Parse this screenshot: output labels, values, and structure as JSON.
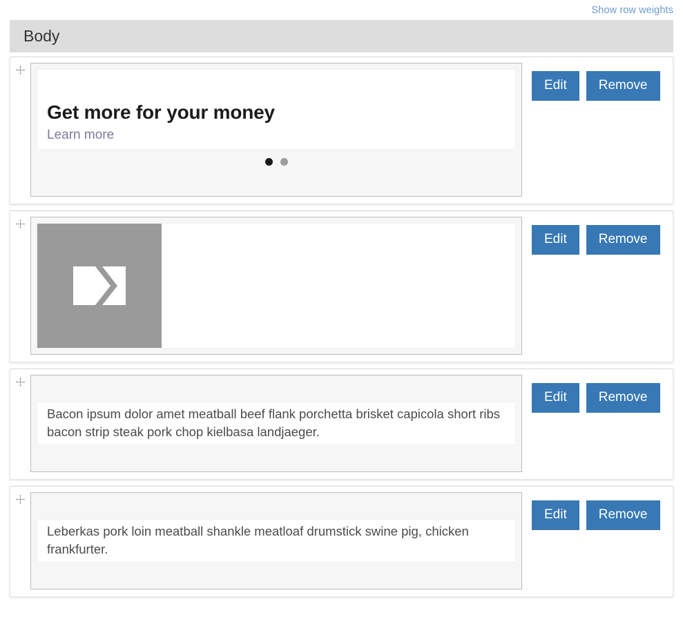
{
  "toolbar": {
    "show_row_weights_label": "Show row weights"
  },
  "field": {
    "title": "Body"
  },
  "actions": {
    "edit_label": "Edit",
    "remove_label": "Remove",
    "drag_icon": "move-handle-icon"
  },
  "colors": {
    "button_blue": "#3778b5",
    "header_gray": "#dddddd",
    "link_blue": "#6a9bd1",
    "promo_link": "#7c7c9e",
    "placeholder_gray": "#9a9a9a",
    "dot_active": "#1a1a1a",
    "dot_inactive": "#9d9d9d"
  },
  "rows": [
    {
      "type": "promo-carousel",
      "title": "Get more for your money",
      "link_label": "Learn more",
      "dots": [
        {
          "active": true
        },
        {
          "active": false
        }
      ]
    },
    {
      "type": "image",
      "image_alt": "broken-image-icon"
    },
    {
      "type": "text",
      "body": "Bacon ipsum dolor amet meatball beef flank porchetta brisket capicola short ribs bacon strip steak pork chop kielbasa landjaeger."
    },
    {
      "type": "text",
      "body": "Leberkas pork loin meatball shankle meatloaf drumstick swine pig, chicken frankfurter."
    }
  ]
}
